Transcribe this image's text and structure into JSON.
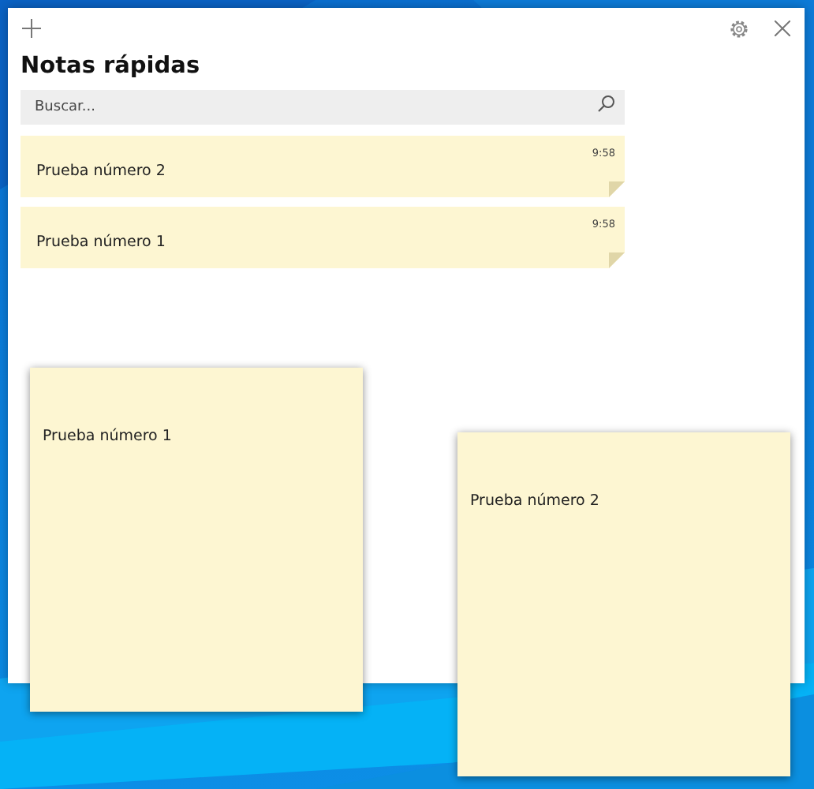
{
  "window": {
    "title": "Notas rápidas"
  },
  "search": {
    "placeholder": "Buscar..."
  },
  "notes_list": [
    {
      "time": "9:58",
      "text": "Prueba número 2"
    },
    {
      "time": "9:58",
      "text": "Prueba número 1"
    }
  ],
  "open_notes": [
    {
      "text": "Prueba número 1"
    },
    {
      "text": "Prueba número 2"
    }
  ]
}
